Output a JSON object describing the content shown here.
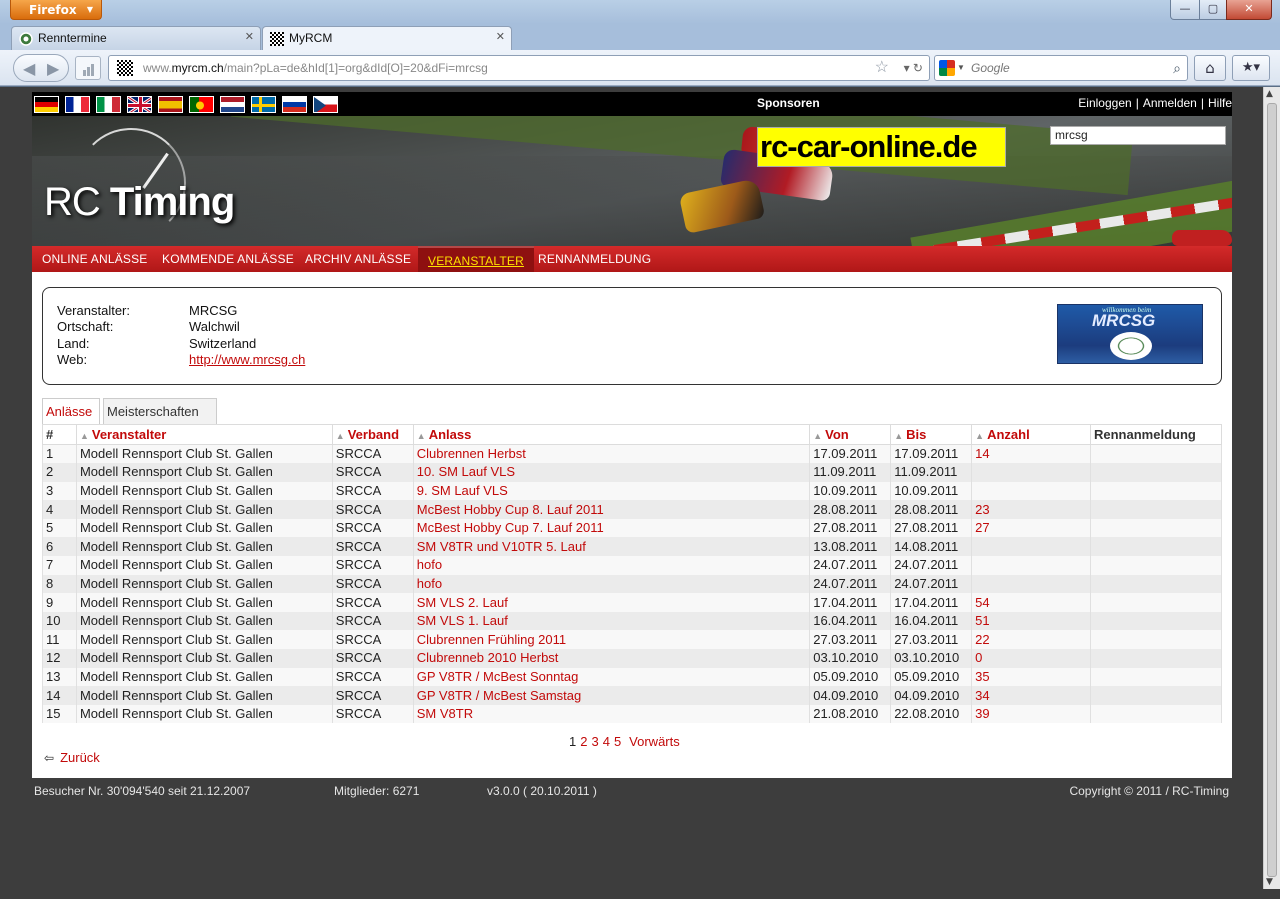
{
  "browser": {
    "menu_button": "Firefox",
    "window_controls": {
      "minimize": "—",
      "maximize": "▢",
      "close": "✕"
    },
    "tabs": [
      {
        "label": "Renntermine",
        "active": false
      },
      {
        "label": "MyRCM",
        "active": true
      }
    ],
    "new_tab": "+",
    "url_prefix": "www.",
    "url_domain": "myrcm.ch",
    "url_rest": "/main?pLa=de&hId[1]=org&dId[O]=20&dFi=mrcsg",
    "search_placeholder": "Google"
  },
  "header": {
    "flags": [
      "german-flag",
      "french-flag",
      "italian-flag",
      "uk-flag",
      "spanish-flag",
      "portuguese-flag",
      "dutch-flag",
      "swedish-flag",
      "russian-flag",
      "czech-flag"
    ],
    "sponsors_label": "Sponsoren",
    "login": "Einloggen",
    "register": "Anmelden",
    "help": "Hilfe",
    "separator": "|",
    "logo_light": "RC ",
    "logo_bold": "Timing",
    "ad_text": "rc-car-online.de",
    "search_value": "mrcsg"
  },
  "menu": [
    {
      "label": "ONLINE ANLÄSSE",
      "active": false
    },
    {
      "label": "KOMMENDE ANLÄSSE",
      "active": false
    },
    {
      "label": "ARCHIV ANLÄSSE",
      "active": false
    },
    {
      "label": "VERANSTALTER",
      "active": true
    },
    {
      "label": "RENNANMELDUNG",
      "active": false
    }
  ],
  "organizer": {
    "labels": {
      "name": "Veranstalter:",
      "place": "Ortschaft:",
      "country": "Land:",
      "web": "Web:"
    },
    "name": "MRCSG",
    "place": "Walchwil",
    "country": "Switzerland",
    "web": "http://www.mrcsg.ch",
    "logo_welcome": "willkommen beim",
    "logo_title": "MRCSG"
  },
  "subtabs": [
    {
      "label": "Anlässe",
      "active": true
    },
    {
      "label": "Meisterschaften",
      "active": false
    }
  ],
  "table": {
    "headers": [
      "#",
      "Veranstalter",
      "Verband",
      "Anlass",
      "Von",
      "Bis",
      "Anzahl",
      "Rennanmeldung"
    ],
    "rows": [
      [
        "1",
        "Modell Rennsport Club St. Gallen",
        "SRCCA",
        "Clubrennen Herbst",
        "17.09.2011",
        "17.09.2011",
        "14",
        ""
      ],
      [
        "2",
        "Modell Rennsport Club St. Gallen",
        "SRCCA",
        "10. SM Lauf VLS",
        "11.09.2011",
        "11.09.2011",
        "",
        ""
      ],
      [
        "3",
        "Modell Rennsport Club St. Gallen",
        "SRCCA",
        "9. SM Lauf VLS",
        "10.09.2011",
        "10.09.2011",
        "",
        ""
      ],
      [
        "4",
        "Modell Rennsport Club St. Gallen",
        "SRCCA",
        "McBest Hobby Cup 8. Lauf 2011",
        "28.08.2011",
        "28.08.2011",
        "23",
        ""
      ],
      [
        "5",
        "Modell Rennsport Club St. Gallen",
        "SRCCA",
        "McBest Hobby Cup 7. Lauf 2011",
        "27.08.2011",
        "27.08.2011",
        "27",
        ""
      ],
      [
        "6",
        "Modell Rennsport Club St. Gallen",
        "SRCCA",
        "SM V8TR und V10TR 5. Lauf",
        "13.08.2011",
        "14.08.2011",
        "",
        ""
      ],
      [
        "7",
        "Modell Rennsport Club St. Gallen",
        "SRCCA",
        "hofo",
        "24.07.2011",
        "24.07.2011",
        "",
        ""
      ],
      [
        "8",
        "Modell Rennsport Club St. Gallen",
        "SRCCA",
        "hofo",
        "24.07.2011",
        "24.07.2011",
        "",
        ""
      ],
      [
        "9",
        "Modell Rennsport Club St. Gallen",
        "SRCCA",
        "SM VLS 2. Lauf",
        "17.04.2011",
        "17.04.2011",
        "54",
        ""
      ],
      [
        "10",
        "Modell Rennsport Club St. Gallen",
        "SRCCA",
        "SM VLS 1. Lauf",
        "16.04.2011",
        "16.04.2011",
        "51",
        ""
      ],
      [
        "11",
        "Modell Rennsport Club St. Gallen",
        "SRCCA",
        "Clubrennen Frühling 2011",
        "27.03.2011",
        "27.03.2011",
        "22",
        ""
      ],
      [
        "12",
        "Modell Rennsport Club St. Gallen",
        "SRCCA",
        "Clubrenneb 2010 Herbst",
        "03.10.2010",
        "03.10.2010",
        "0",
        ""
      ],
      [
        "13",
        "Modell Rennsport Club St. Gallen",
        "SRCCA",
        "GP V8TR / McBest Sonntag",
        "05.09.2010",
        "05.09.2010",
        "35",
        ""
      ],
      [
        "14",
        "Modell Rennsport Club St. Gallen",
        "SRCCA",
        "GP V8TR / McBest Samstag",
        "04.09.2010",
        "04.09.2010",
        "34",
        ""
      ],
      [
        "15",
        "Modell Rennsport Club St. Gallen",
        "SRCCA",
        "SM V8TR",
        "21.08.2010",
        "22.08.2010",
        "39",
        ""
      ]
    ]
  },
  "pagination": {
    "pages": [
      "1",
      "2",
      "3",
      "4",
      "5"
    ],
    "current": "1",
    "next": "Vorwärts"
  },
  "back_link": "Zurück",
  "footer": {
    "visitors": "Besucher Nr. 30'094'540 seit 21.12.2007",
    "members": "Mitglieder: 6271",
    "version": "v3.0.0 ( 20.10.2011 )",
    "copyright": "Copyright © 2011 / RC-Timing"
  },
  "colors": {
    "accent_red": "#c20a0a",
    "menu_red": "#c41f1f",
    "active_menu_text": "#ffe100",
    "ad_yellow": "#ffff00"
  }
}
